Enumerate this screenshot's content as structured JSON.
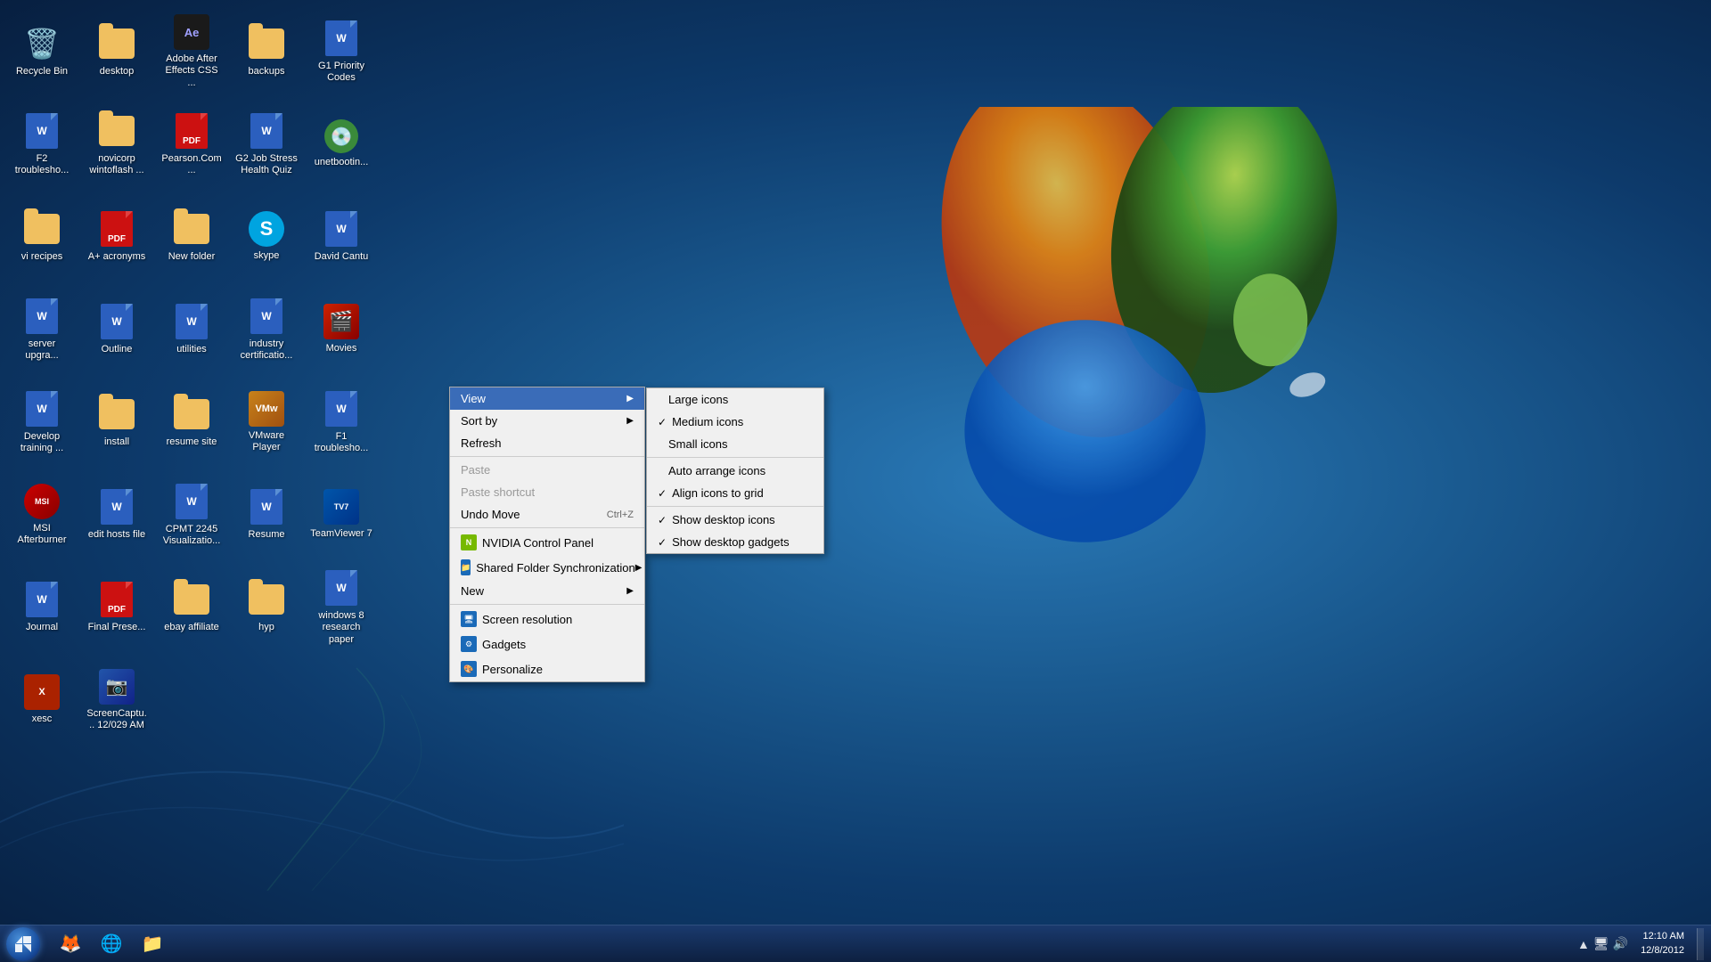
{
  "desktop": {
    "icons": [
      {
        "id": "recycle-bin",
        "label": "Recycle Bin",
        "type": "recycle",
        "row": 0,
        "col": 0
      },
      {
        "id": "desktop",
        "label": "desktop",
        "type": "folder",
        "row": 0,
        "col": 1
      },
      {
        "id": "adobe-after-effects",
        "label": "Adobe After Effects CSS ...",
        "type": "app-ae",
        "row": 0,
        "col": 2
      },
      {
        "id": "backups",
        "label": "backups",
        "type": "folder",
        "row": 0,
        "col": 3
      },
      {
        "id": "g1-priority-codes",
        "label": "G1 Priority Codes",
        "type": "word",
        "row": 0,
        "col": 4
      },
      {
        "id": "f2-troubleshoot",
        "label": "F2 troublesho...",
        "type": "word",
        "row": 0,
        "col": 5
      },
      {
        "id": "novicorp-wintoflash",
        "label": "novicorp wintoflash ...",
        "type": "folder",
        "row": 0,
        "col": 6
      },
      {
        "id": "pearson-com",
        "label": "Pearson.Com...",
        "type": "pdf",
        "row": 1,
        "col": 0
      },
      {
        "id": "g2-job-stress",
        "label": "G2 Job Stress Health Quiz",
        "type": "word",
        "row": 1,
        "col": 1
      },
      {
        "id": "unetbootin",
        "label": "unetbootin...",
        "type": "app-unet",
        "row": 1,
        "col": 2
      },
      {
        "id": "vi-recipes",
        "label": "vi recipes",
        "type": "folder",
        "row": 1,
        "col": 3
      },
      {
        "id": "a-plus-acronyms",
        "label": "A+ acronyms",
        "type": "pdf",
        "row": 1,
        "col": 4
      },
      {
        "id": "new-folder",
        "label": "New folder",
        "type": "folder",
        "row": 1,
        "col": 5
      },
      {
        "id": "skype",
        "label": "skype",
        "type": "app-skype",
        "row": 2,
        "col": 0
      },
      {
        "id": "david-cantu",
        "label": "David Cantu",
        "type": "word",
        "row": 2,
        "col": 1
      },
      {
        "id": "server-upgrade",
        "label": "server upgra...",
        "type": "word",
        "row": 2,
        "col": 2
      },
      {
        "id": "outline",
        "label": "Outline",
        "type": "word",
        "row": 2,
        "col": 3
      },
      {
        "id": "utilities",
        "label": "utilities",
        "type": "word",
        "row": 2,
        "col": 4
      },
      {
        "id": "industry-certification",
        "label": "industry certificatio...",
        "type": "word",
        "row": 2,
        "col": 5
      },
      {
        "id": "movies",
        "label": "Movies",
        "type": "app-movies",
        "row": 3,
        "col": 0
      },
      {
        "id": "develop-training",
        "label": "Develop training ...",
        "type": "word",
        "row": 3,
        "col": 1
      },
      {
        "id": "install",
        "label": "install",
        "type": "folder",
        "row": 3,
        "col": 2
      },
      {
        "id": "resume-site",
        "label": "resume site",
        "type": "folder",
        "row": 3,
        "col": 3
      },
      {
        "id": "vmware-player",
        "label": "VMware Player",
        "type": "app-vmware",
        "row": 3,
        "col": 4
      },
      {
        "id": "f1-troubleshoot",
        "label": "F1 troublesho...",
        "type": "word",
        "row": 3,
        "col": 5
      },
      {
        "id": "msi-afterburner",
        "label": "MSI Afterburner",
        "type": "app-msi",
        "row": 4,
        "col": 0
      },
      {
        "id": "edit-hosts-file",
        "label": "edit hosts file",
        "type": "word",
        "row": 4,
        "col": 1
      },
      {
        "id": "cpmt-2245",
        "label": "CPMT 2245 Visualizatio...",
        "type": "word",
        "row": 4,
        "col": 2
      },
      {
        "id": "resume",
        "label": "Resume",
        "type": "word",
        "row": 4,
        "col": 3
      },
      {
        "id": "teamviewer",
        "label": "TeamViewer 7",
        "type": "app-tv",
        "row": 5,
        "col": 0
      },
      {
        "id": "journal",
        "label": "Journal",
        "type": "word",
        "row": 5,
        "col": 1
      },
      {
        "id": "final-presentation",
        "label": "Final Prese...",
        "type": "pdf",
        "row": 5,
        "col": 2
      },
      {
        "id": "ebay-affiliate",
        "label": "ebay affiliate",
        "type": "folder",
        "row": 5,
        "col": 3
      },
      {
        "id": "hyp",
        "label": "hyp",
        "type": "folder",
        "row": 6,
        "col": 0
      },
      {
        "id": "windows8-research",
        "label": "windows 8 research paper",
        "type": "word",
        "row": 6,
        "col": 1
      },
      {
        "id": "xesc",
        "label": "xesc",
        "type": "app-xesc",
        "row": 7,
        "col": 0
      },
      {
        "id": "screencapture",
        "label": "ScreenCaptu... 12/029 AM",
        "type": "app-sc",
        "row": 7,
        "col": 1
      }
    ]
  },
  "context_menu": {
    "items": [
      {
        "id": "view",
        "label": "View",
        "type": "arrow",
        "has_icon": false,
        "disabled": false
      },
      {
        "id": "sort-by",
        "label": "Sort by",
        "type": "arrow",
        "has_icon": false,
        "disabled": false
      },
      {
        "id": "refresh",
        "label": "Refresh",
        "type": "normal",
        "has_icon": false,
        "disabled": false
      },
      {
        "id": "sep1",
        "type": "separator"
      },
      {
        "id": "paste",
        "label": "Paste",
        "type": "normal",
        "has_icon": false,
        "disabled": true
      },
      {
        "id": "paste-shortcut",
        "label": "Paste shortcut",
        "type": "normal",
        "has_icon": false,
        "disabled": true
      },
      {
        "id": "undo-move",
        "label": "Undo Move",
        "type": "shortcut",
        "shortcut": "Ctrl+Z",
        "has_icon": false,
        "disabled": false
      },
      {
        "id": "sep2",
        "type": "separator"
      },
      {
        "id": "nvidia",
        "label": "NVIDIA Control Panel",
        "type": "icon-item",
        "icon_color": "#76b900",
        "disabled": false
      },
      {
        "id": "shared-folder",
        "label": "Shared Folder Synchronization",
        "type": "icon-arrow",
        "icon_color": "#1a6ab8",
        "disabled": false
      },
      {
        "id": "new",
        "label": "New",
        "type": "arrow",
        "has_icon": false,
        "disabled": false
      },
      {
        "id": "sep3",
        "type": "separator"
      },
      {
        "id": "screen-resolution",
        "label": "Screen resolution",
        "type": "icon-item",
        "icon_color": "#1a6ab8",
        "disabled": false
      },
      {
        "id": "gadgets",
        "label": "Gadgets",
        "type": "icon-item",
        "icon_color": "#1a6ab8",
        "disabled": false
      },
      {
        "id": "personalize",
        "label": "Personalize",
        "type": "icon-item",
        "icon_color": "#1a6ab8",
        "disabled": false
      }
    ]
  },
  "view_submenu": {
    "items": [
      {
        "id": "large-icons",
        "label": "Large icons",
        "checked": false
      },
      {
        "id": "medium-icons",
        "label": "Medium icons",
        "checked": true
      },
      {
        "id": "small-icons",
        "label": "Small icons",
        "checked": false
      },
      {
        "id": "sep1",
        "type": "separator"
      },
      {
        "id": "auto-arrange",
        "label": "Auto arrange icons",
        "checked": false
      },
      {
        "id": "align-grid",
        "label": "Align icons to grid",
        "checked": true
      },
      {
        "id": "sep2",
        "type": "separator"
      },
      {
        "id": "show-desktop",
        "label": "Show desktop icons",
        "checked": true
      },
      {
        "id": "show-gadgets",
        "label": "Show desktop gadgets",
        "checked": true
      }
    ]
  },
  "taskbar": {
    "start_label": "Start",
    "time": "12:10 AM",
    "date": "12/8/2012",
    "tray_icons": [
      "▲",
      "🔊",
      "🖥",
      "🌐"
    ]
  }
}
